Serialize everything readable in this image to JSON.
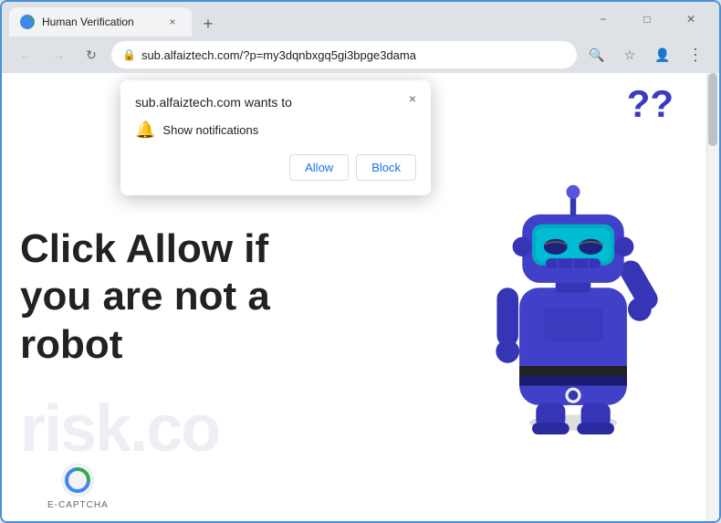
{
  "browser": {
    "tab_title": "Human Verification",
    "tab_favicon": "G",
    "tab_close_label": "×",
    "new_tab_label": "+",
    "window_minimize": "−",
    "window_maximize": "□",
    "window_close": "✕",
    "nav_back": "←",
    "nav_forward": "→",
    "nav_refresh": "↻",
    "url": "sub.alfaiztech.com/?p=my3dqnbxgq5gi3bpge3dama",
    "url_full": "sub.alfaiztech.com/?p=my3dqnbxgq5gi3bpge3dama",
    "search_icon": "🔍",
    "bookmark_icon": "☆",
    "profile_icon": "👤",
    "menu_icon": "⋮"
  },
  "popup": {
    "title": "sub.alfaiztech.com wants to",
    "notification_text": "Show notifications",
    "allow_label": "Allow",
    "block_label": "Block",
    "close_icon": "×"
  },
  "page": {
    "main_text": "Click Allow if you are not a robot",
    "watermark": "risk.co",
    "question_marks": "??",
    "ecaptcha_label": "E-CAPTCHA",
    "ecaptcha_logo": "C"
  },
  "colors": {
    "browser_frame": "#dee1e6",
    "accent_blue": "#1a73e8",
    "robot_body": "#4040c8",
    "robot_head_screen": "#00bcd4"
  }
}
